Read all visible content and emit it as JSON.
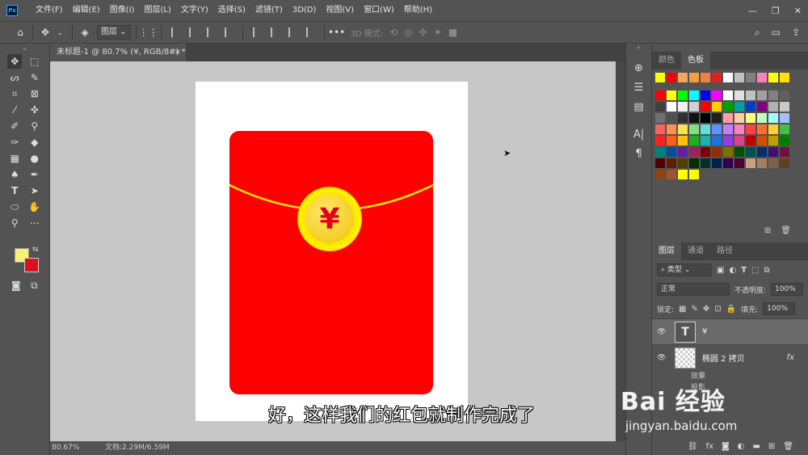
{
  "app": {
    "logo": "Ps"
  },
  "menu": [
    "文件(F)",
    "编辑(E)",
    "图像(I)",
    "图层(L)",
    "文字(Y)",
    "选择(S)",
    "滤镜(T)",
    "3D(D)",
    "视图(V)",
    "窗口(W)",
    "帮助(H)"
  ],
  "window_controls": {
    "minimize": "—",
    "restore": "❐",
    "close": "✕"
  },
  "options": {
    "layer_select": "图层 ⌄",
    "mode_3d": "3D 模式:"
  },
  "document": {
    "tab_title": "未标题-1 @ 80.7% (¥, RGB/8#) *",
    "tab_close": "×",
    "zoom": "80.67%",
    "doc_size": "文档:2.29M/6.59M",
    "coin_symbol": "¥",
    "subtitle": "好，这样我们的红包就制作完成了"
  },
  "colors": {
    "foreground": "#f6f170",
    "background": "#d9111c",
    "envelope": "#ff0000"
  },
  "panels": {
    "tabs_top": [
      "颜色",
      "色板"
    ],
    "tabs_layers": [
      "图层",
      "通道",
      "路径"
    ],
    "filter_label": "类型",
    "blend_mode": "正常",
    "opacity_label": "不透明度:",
    "opacity_value": "100%",
    "lock_label": "锁定:",
    "fill_label": "填充:",
    "fill_value": "100%"
  },
  "layers": [
    {
      "name": "¥",
      "kind": "text",
      "selected": true
    },
    {
      "name": "椭圆 2 拷贝",
      "kind": "shape",
      "fx": "fx"
    }
  ],
  "layer_effects": [
    "效果",
    "投影"
  ],
  "swatches": {
    "recent": [
      "#ffff00",
      "#ff0000",
      "#f4a460",
      "#f0a040",
      "#f08040",
      "#e02020",
      "#ffffff",
      "#c0c0c0",
      "#808080",
      "#ff80c0",
      "#ffff00",
      "#ffe000"
    ],
    "grid": [
      "#ff0000",
      "#ffff00",
      "#00ff00",
      "#00ffff",
      "#0000ff",
      "#ff00ff",
      "#ffffff",
      "#e0e0e0",
      "#c0c0c0",
      "#a0a0a0",
      "#808080",
      "#606060",
      "#404040",
      "#ffffff",
      "#f0f0f0",
      "#d0d0d0",
      "#ff0000",
      "#ffcc00",
      "#00a000",
      "#00a0a0",
      "#0040c0",
      "#800080",
      "#b0b0b0",
      "#c8c8c8",
      "#707070",
      "#505050",
      "#303030",
      "#101010",
      "#000000",
      "#202020",
      "#ffa0a0",
      "#ffd0a0",
      "#ffff80",
      "#c0ffc0",
      "#a0ffff",
      "#a0c0ff",
      "#ff6060",
      "#ff9050",
      "#ffe050",
      "#80e080",
      "#60e0e0",
      "#6090ff",
      "#c080ff",
      "#ff80c0",
      "#ff4040",
      "#ff7030",
      "#ffd030",
      "#40c040",
      "#ff2020",
      "#ff6010",
      "#ffc010",
      "#20b020",
      "#20b0b0",
      "#2070e0",
      "#9040e0",
      "#e04090",
      "#c00000",
      "#d05000",
      "#c0a000",
      "#008000",
      "#008080",
      "#0050a0",
      "#6020a0",
      "#a02060",
      "#800000",
      "#903000",
      "#807000",
      "#005000",
      "#005050",
      "#003070",
      "#401070",
      "#701040",
      "#500000",
      "#602000",
      "#504000",
      "#003000",
      "#003030",
      "#002050",
      "#300050",
      "#500030",
      "#c8a080",
      "#a08060",
      "#806040",
      "#604020"
    ],
    "extra": [
      "#8b4513",
      "#a0522d",
      "#ffff00",
      "#ffff00"
    ]
  },
  "watermark": {
    "logo": "Bai 经验",
    "url": "jingyan.baidu.com"
  }
}
